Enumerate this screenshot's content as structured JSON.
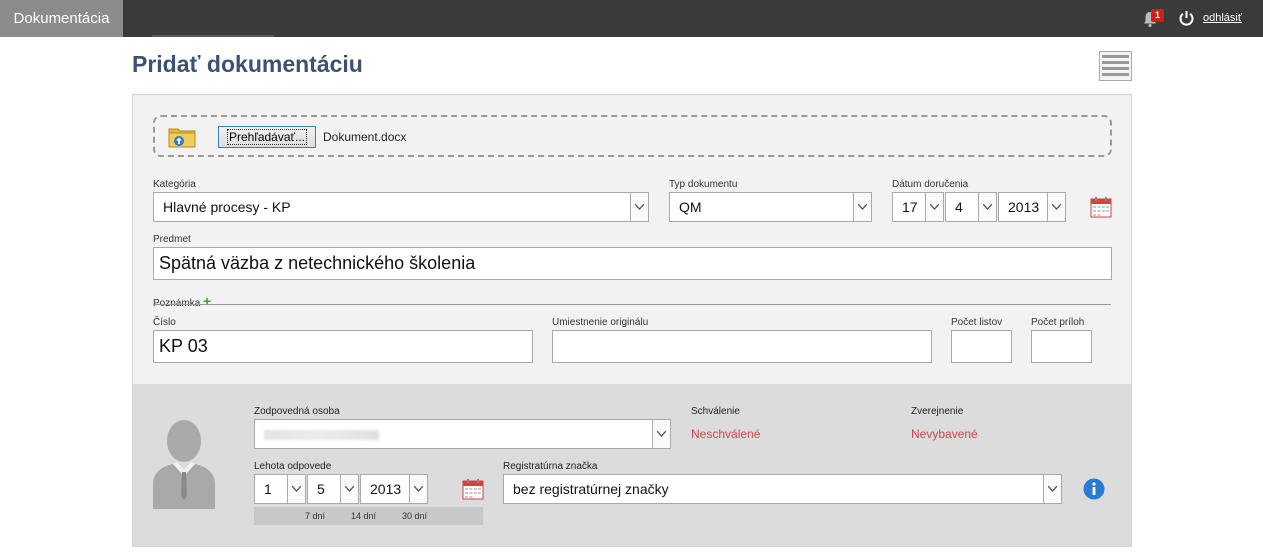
{
  "header": {
    "app_tab": "Dokumentácia",
    "notification_count": "1",
    "logout_label": "odhlásiť"
  },
  "page": {
    "title": "Pridať dokumentáciu"
  },
  "upload": {
    "browse_label": "Prehľadávať...",
    "file_name": "Dokument.docx"
  },
  "form": {
    "category": {
      "label": "Kategória",
      "value": "Hlavné procesy - KP"
    },
    "doc_type": {
      "label": "Typ dokumentu",
      "value": "QM"
    },
    "delivery_date": {
      "label": "Dátum doručenia",
      "day": "17",
      "month": "4",
      "year": "2013"
    },
    "subject": {
      "label": "Predmet",
      "value": "Spätná väzba z netechnického školenia"
    },
    "note": {
      "label": "Poznámka",
      "add_symbol": "+"
    },
    "number": {
      "label": "Číslo",
      "value": "KP 03"
    },
    "original_location": {
      "label": "Umiestnenie originálu",
      "value": ""
    },
    "sheet_count": {
      "label": "Počet listov",
      "value": ""
    },
    "attachment_count": {
      "label": "Počet príloh",
      "value": ""
    }
  },
  "responsibility": {
    "person": {
      "label": "Zodpovedná osoba",
      "value": ""
    },
    "approval": {
      "label": "Schválenie",
      "value": "Neschválené"
    },
    "publication": {
      "label": "Zverejnenie",
      "value": "Nevybavené"
    },
    "deadline": {
      "label": "Lehota odpovede",
      "day": "1",
      "month": "5",
      "year": "2013"
    },
    "quick_days": [
      "7 dní",
      "14 dní",
      "30 dní"
    ],
    "registry_mark": {
      "label": "Registratúrna značka",
      "value": "bez registratúrnej značky"
    }
  },
  "colors": {
    "title": "#3d5270",
    "status_red": "#c8494b",
    "accent_blue": "#2a7bd3"
  }
}
